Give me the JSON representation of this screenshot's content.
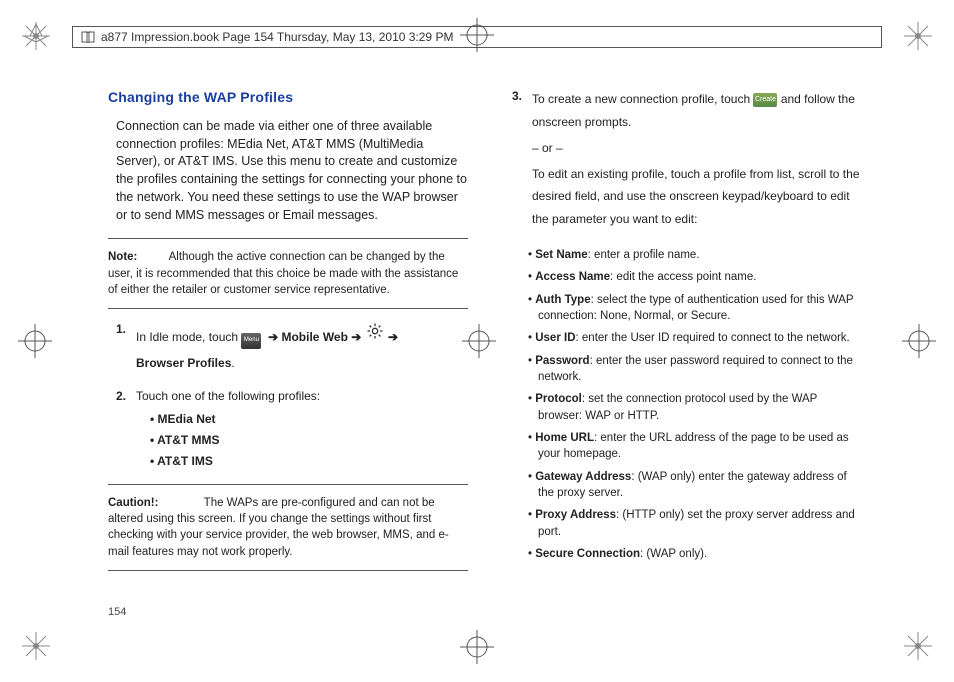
{
  "header": {
    "text": "a877 Impression.book  Page 154  Thursday, May 13, 2010  3:29 PM"
  },
  "page_number": "154",
  "left": {
    "title": "Changing the WAP Profiles",
    "intro": "Connection can be made via either one of three available connection profiles: MEdia Net, AT&T MMS (MultiMedia Server), or AT&T IMS. Use this menu to create and customize the profiles containing the settings for connecting your phone to the network. You need these settings to use the WAP browser or to send MMS messages or Email messages.",
    "note_label": "Note:",
    "note_body": "Although the active connection can be changed by the user, it is recommended that this choice be made with the assistance of either the retailer or customer service representative.",
    "step1_num": "1.",
    "step1_pre": "In Idle mode, touch ",
    "nav_mobile_web": "Mobile Web",
    "nav_browser_profiles": "Browser Profiles",
    "arrow": "➔",
    "step2_num": "2.",
    "step2_text": "Touch one of the following profiles:",
    "profiles": [
      "MEdia Net",
      "AT&T MMS",
      "AT&T IMS"
    ],
    "caution_label": "Caution!:",
    "caution_body": "The WAPs are pre-configured and can not be altered using this screen. If you change the settings without first checking with your service provider, the web browser, MMS, and e-mail features may not work properly."
  },
  "right": {
    "step3_num": "3.",
    "step3_pre": "To create a new connection profile, touch ",
    "step3_post": " and follow the onscreen prompts.",
    "or": "– or –",
    "edit_text": "To edit an existing profile, touch a profile from list, scroll to the desired field, and use the onscreen keypad/keyboard to edit the parameter you want to edit:",
    "fields": [
      {
        "name": "Set Name",
        "desc": ": enter a profile name."
      },
      {
        "name": "Access Name",
        "desc": ": edit the access point name."
      },
      {
        "name": "Auth Type",
        "desc": ": select the type of authentication used for this WAP connection: None, Normal, or Secure."
      },
      {
        "name": "User ID",
        "desc": ": enter the User ID required to connect to the network."
      },
      {
        "name": "Password",
        "desc": ": enter the user password required to connect to the network."
      },
      {
        "name": "Protocol",
        "desc": ": set the connection protocol used by the WAP browser: WAP or HTTP."
      },
      {
        "name": "Home URL",
        "desc": ": enter the URL address of the page to be used as your homepage."
      },
      {
        "name": "Gateway Address",
        "desc": ": (WAP only) enter the gateway address of the proxy server."
      },
      {
        "name": "Proxy Address",
        "desc": ": (HTTP only) set the proxy server address and port."
      },
      {
        "name": "Secure Connection",
        "desc": ": (WAP only)."
      }
    ]
  },
  "icons": {
    "menu": "Menu",
    "create": "Create"
  }
}
